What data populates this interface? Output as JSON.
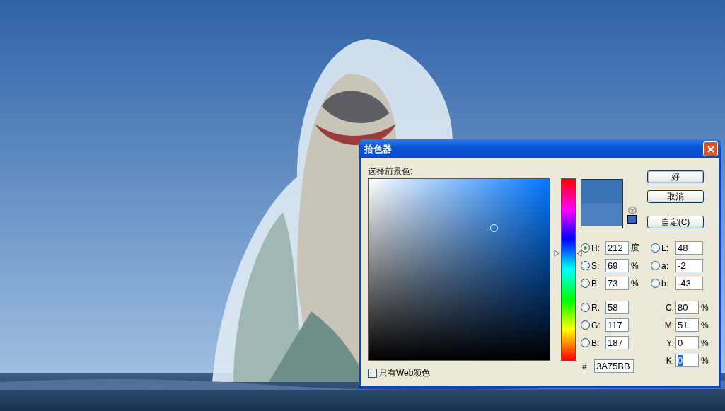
{
  "window": {
    "title": "拾色器"
  },
  "prompt": "选择前景色:",
  "hue_slider": {
    "level": 0.589
  },
  "swatches": [
    {
      "color": "#3a72b5"
    },
    {
      "color": "#4a80c0"
    }
  ],
  "web_safe_swatch": {
    "color": "#3366cc"
  },
  "buttons": [
    {
      "label": "好",
      "default": true
    },
    {
      "label": "取消",
      "default": false
    },
    {
      "label": "自定(C)",
      "default": false
    }
  ],
  "hsb": [
    {
      "label": "H:",
      "value": "212",
      "unit": "度",
      "selected": true
    },
    {
      "label": "S:",
      "value": "69",
      "unit": "%",
      "selected": false
    },
    {
      "label": "B:",
      "value": "73",
      "unit": "%",
      "selected": false
    }
  ],
  "lab": [
    {
      "label": "L:",
      "value": "48",
      "selected": false
    },
    {
      "label": "a:",
      "value": "-2",
      "selected": false
    },
    {
      "label": "b:",
      "value": "-43",
      "selected": false
    }
  ],
  "rgb": [
    {
      "label": "R:",
      "value": "58",
      "selected": false
    },
    {
      "label": "G:",
      "value": "117",
      "selected": false
    },
    {
      "label": "B:",
      "value": "187",
      "selected": false
    }
  ],
  "hex": {
    "label": "#",
    "value": "3A75BB"
  },
  "cmyk": [
    {
      "label": "C:",
      "value": "80",
      "unit": "%",
      "highlighted": false
    },
    {
      "label": "M:",
      "value": "51",
      "unit": "%",
      "highlighted": false
    },
    {
      "label": "Y:",
      "value": "0",
      "unit": "%",
      "highlighted": false
    },
    {
      "label": "K:",
      "value": "0",
      "unit": "%",
      "highlighted": true
    }
  ],
  "web_only": {
    "label": "只有Web颜色",
    "checked": false
  }
}
